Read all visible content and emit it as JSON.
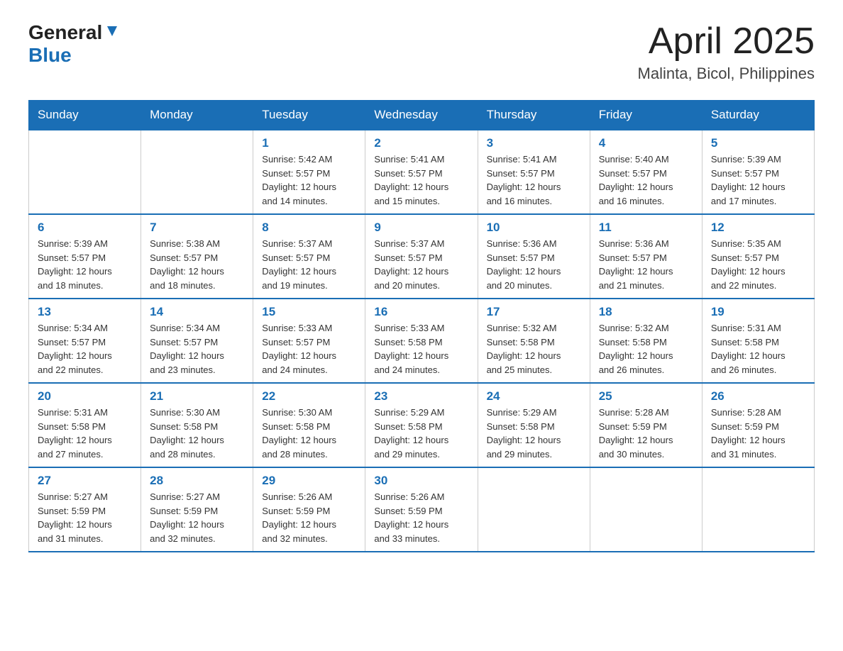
{
  "header": {
    "logo_general": "General",
    "logo_blue": "Blue",
    "month_title": "April 2025",
    "location": "Malinta, Bicol, Philippines"
  },
  "days_of_week": [
    "Sunday",
    "Monday",
    "Tuesday",
    "Wednesday",
    "Thursday",
    "Friday",
    "Saturday"
  ],
  "weeks": [
    [
      {
        "day": "",
        "info": ""
      },
      {
        "day": "",
        "info": ""
      },
      {
        "day": "1",
        "info": "Sunrise: 5:42 AM\nSunset: 5:57 PM\nDaylight: 12 hours\nand 14 minutes."
      },
      {
        "day": "2",
        "info": "Sunrise: 5:41 AM\nSunset: 5:57 PM\nDaylight: 12 hours\nand 15 minutes."
      },
      {
        "day": "3",
        "info": "Sunrise: 5:41 AM\nSunset: 5:57 PM\nDaylight: 12 hours\nand 16 minutes."
      },
      {
        "day": "4",
        "info": "Sunrise: 5:40 AM\nSunset: 5:57 PM\nDaylight: 12 hours\nand 16 minutes."
      },
      {
        "day": "5",
        "info": "Sunrise: 5:39 AM\nSunset: 5:57 PM\nDaylight: 12 hours\nand 17 minutes."
      }
    ],
    [
      {
        "day": "6",
        "info": "Sunrise: 5:39 AM\nSunset: 5:57 PM\nDaylight: 12 hours\nand 18 minutes."
      },
      {
        "day": "7",
        "info": "Sunrise: 5:38 AM\nSunset: 5:57 PM\nDaylight: 12 hours\nand 18 minutes."
      },
      {
        "day": "8",
        "info": "Sunrise: 5:37 AM\nSunset: 5:57 PM\nDaylight: 12 hours\nand 19 minutes."
      },
      {
        "day": "9",
        "info": "Sunrise: 5:37 AM\nSunset: 5:57 PM\nDaylight: 12 hours\nand 20 minutes."
      },
      {
        "day": "10",
        "info": "Sunrise: 5:36 AM\nSunset: 5:57 PM\nDaylight: 12 hours\nand 20 minutes."
      },
      {
        "day": "11",
        "info": "Sunrise: 5:36 AM\nSunset: 5:57 PM\nDaylight: 12 hours\nand 21 minutes."
      },
      {
        "day": "12",
        "info": "Sunrise: 5:35 AM\nSunset: 5:57 PM\nDaylight: 12 hours\nand 22 minutes."
      }
    ],
    [
      {
        "day": "13",
        "info": "Sunrise: 5:34 AM\nSunset: 5:57 PM\nDaylight: 12 hours\nand 22 minutes."
      },
      {
        "day": "14",
        "info": "Sunrise: 5:34 AM\nSunset: 5:57 PM\nDaylight: 12 hours\nand 23 minutes."
      },
      {
        "day": "15",
        "info": "Sunrise: 5:33 AM\nSunset: 5:57 PM\nDaylight: 12 hours\nand 24 minutes."
      },
      {
        "day": "16",
        "info": "Sunrise: 5:33 AM\nSunset: 5:58 PM\nDaylight: 12 hours\nand 24 minutes."
      },
      {
        "day": "17",
        "info": "Sunrise: 5:32 AM\nSunset: 5:58 PM\nDaylight: 12 hours\nand 25 minutes."
      },
      {
        "day": "18",
        "info": "Sunrise: 5:32 AM\nSunset: 5:58 PM\nDaylight: 12 hours\nand 26 minutes."
      },
      {
        "day": "19",
        "info": "Sunrise: 5:31 AM\nSunset: 5:58 PM\nDaylight: 12 hours\nand 26 minutes."
      }
    ],
    [
      {
        "day": "20",
        "info": "Sunrise: 5:31 AM\nSunset: 5:58 PM\nDaylight: 12 hours\nand 27 minutes."
      },
      {
        "day": "21",
        "info": "Sunrise: 5:30 AM\nSunset: 5:58 PM\nDaylight: 12 hours\nand 28 minutes."
      },
      {
        "day": "22",
        "info": "Sunrise: 5:30 AM\nSunset: 5:58 PM\nDaylight: 12 hours\nand 28 minutes."
      },
      {
        "day": "23",
        "info": "Sunrise: 5:29 AM\nSunset: 5:58 PM\nDaylight: 12 hours\nand 29 minutes."
      },
      {
        "day": "24",
        "info": "Sunrise: 5:29 AM\nSunset: 5:58 PM\nDaylight: 12 hours\nand 29 minutes."
      },
      {
        "day": "25",
        "info": "Sunrise: 5:28 AM\nSunset: 5:59 PM\nDaylight: 12 hours\nand 30 minutes."
      },
      {
        "day": "26",
        "info": "Sunrise: 5:28 AM\nSunset: 5:59 PM\nDaylight: 12 hours\nand 31 minutes."
      }
    ],
    [
      {
        "day": "27",
        "info": "Sunrise: 5:27 AM\nSunset: 5:59 PM\nDaylight: 12 hours\nand 31 minutes."
      },
      {
        "day": "28",
        "info": "Sunrise: 5:27 AM\nSunset: 5:59 PM\nDaylight: 12 hours\nand 32 minutes."
      },
      {
        "day": "29",
        "info": "Sunrise: 5:26 AM\nSunset: 5:59 PM\nDaylight: 12 hours\nand 32 minutes."
      },
      {
        "day": "30",
        "info": "Sunrise: 5:26 AM\nSunset: 5:59 PM\nDaylight: 12 hours\nand 33 minutes."
      },
      {
        "day": "",
        "info": ""
      },
      {
        "day": "",
        "info": ""
      },
      {
        "day": "",
        "info": ""
      }
    ]
  ]
}
